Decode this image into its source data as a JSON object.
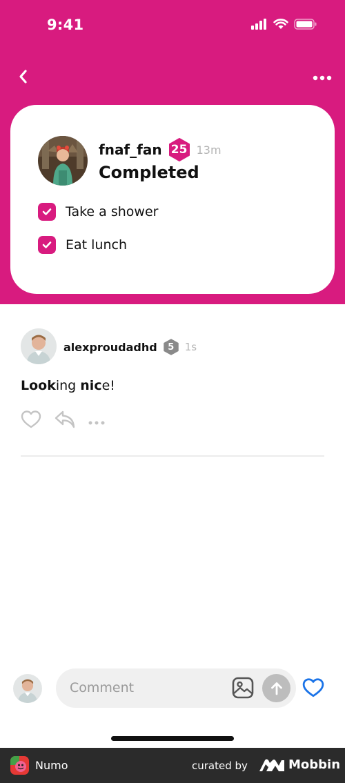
{
  "status_bar": {
    "time": "9:41"
  },
  "post": {
    "username": "fnaf_fan",
    "level": "25",
    "time": "13m",
    "title": "Completed",
    "tasks": [
      {
        "label": "Take a shower",
        "checked": true
      },
      {
        "label": "Eat lunch",
        "checked": true
      }
    ]
  },
  "comment": {
    "username": "alexproudadhd",
    "level": "5",
    "time": "1s",
    "text_parts": [
      "Look",
      "ing ",
      "nic",
      "e!"
    ]
  },
  "composer": {
    "placeholder": "Comment"
  },
  "footer": {
    "app_name": "Numo",
    "curated_by": "curated by",
    "brand": "Mobbin"
  },
  "colors": {
    "accent": "#d81b7f",
    "like_blue": "#1a73e8",
    "badge_gray": "#8a8a8a"
  }
}
